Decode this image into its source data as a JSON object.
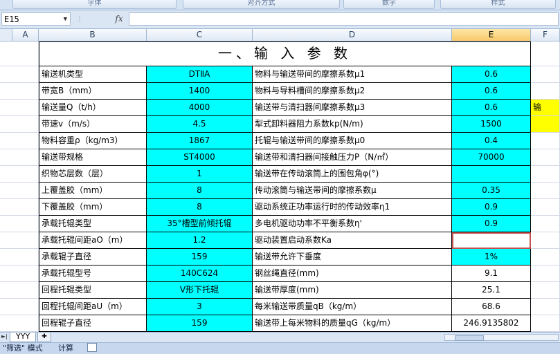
{
  "ribbon": {
    "groups": [
      "字体",
      "对齐方式",
      "数字",
      "样式"
    ]
  },
  "formula_bar": {
    "name_box": "E15",
    "fx_label": "fx",
    "content": ""
  },
  "columns": [
    "A",
    "B",
    "C",
    "D",
    "E",
    "F"
  ],
  "selected_column": "E",
  "title": "一、输 入 参 数",
  "rows": [
    {
      "label": "输送机类型",
      "value": "DTⅡA",
      "param": "物料与输送带间的摩擦系数μ1",
      "pvalue": "0.6",
      "extra": ""
    },
    {
      "label": "带宽B（mm）",
      "value": "1400",
      "param": "物料与导料槽间的摩擦系数μ2",
      "pvalue": "0.6",
      "extra": ""
    },
    {
      "label": "输送量Q（t/h）",
      "value": "4000",
      "param": "输送带与清扫器间摩擦系数μ3",
      "pvalue": "0.6",
      "extra": "输"
    },
    {
      "label": "带速v（m/s）",
      "value": "4.5",
      "param": "犁式卸料器阻力系数kp(N/m)",
      "pvalue": "1500",
      "extra": " "
    },
    {
      "label": "物料容重ρ（kg/m3）",
      "value": "1867",
      "param": "托辊与输送带间的摩擦系数μ0",
      "pvalue": "0.4",
      "extra": ""
    },
    {
      "label": "输送带规格",
      "value": "ST4000",
      "param": "输送带和清扫器间接触压力P（N/㎡）",
      "pvalue": "70000",
      "extra": ""
    },
    {
      "label": "织物芯层数（层）",
      "value": "1",
      "param": "输送带在传动滚筒上的围包角φ(°)",
      "pvalue": "",
      "extra": ""
    },
    {
      "label": "上覆盖胶（mm）",
      "value": "8",
      "param": "传动滚筒与输送带间的摩擦系数μ",
      "pvalue": "0.35",
      "extra": ""
    },
    {
      "label": "下覆盖胶（mm）",
      "value": "8",
      "param": "驱动系统正功率运行时的传动效率η1",
      "pvalue": "0.9",
      "extra": ""
    },
    {
      "label": "承载托辊类型",
      "value": "35°槽型前倾托辊",
      "param": "多电机驱动功率不平衡系数η'",
      "pvalue": "0.9",
      "extra": ""
    },
    {
      "label": "承载托辊间距aO（m）",
      "value": "1.2",
      "param": "驱动装置启动系数Ka",
      "pvalue": "",
      "extra": ""
    },
    {
      "label": "承载辊子直径",
      "value": "159",
      "param": "输送带允许下垂度",
      "pvalue": "1%",
      "extra": ""
    },
    {
      "label": "承载托辊型号",
      "value": "140C624",
      "param": "钢丝绳直径(mm)",
      "pvalue": "9.1",
      "extra": ""
    },
    {
      "label": "回程托辊类型",
      "value": "V形下托辊",
      "param": "输送带厚度(mm)",
      "pvalue": "25.1",
      "extra": ""
    },
    {
      "label": "回程托辊间距aU（m）",
      "value": "3",
      "param": "每米输送带质量qB（kg/m）",
      "pvalue": "68.6",
      "extra": ""
    },
    {
      "label": "回程辊子直径",
      "value": "159",
      "param": "输送带上每米物料的质量qG（kg/m）",
      "pvalue": "246.9135802",
      "extra": ""
    }
  ],
  "sheet_tabs": [
    "YYY"
  ],
  "status_bar": {
    "mode": "\"筛选\" 模式",
    "calc": "计算"
  },
  "colors": {
    "cyan": "#00ffff",
    "yellow": "#ffff00",
    "selection": "#c0504d"
  }
}
